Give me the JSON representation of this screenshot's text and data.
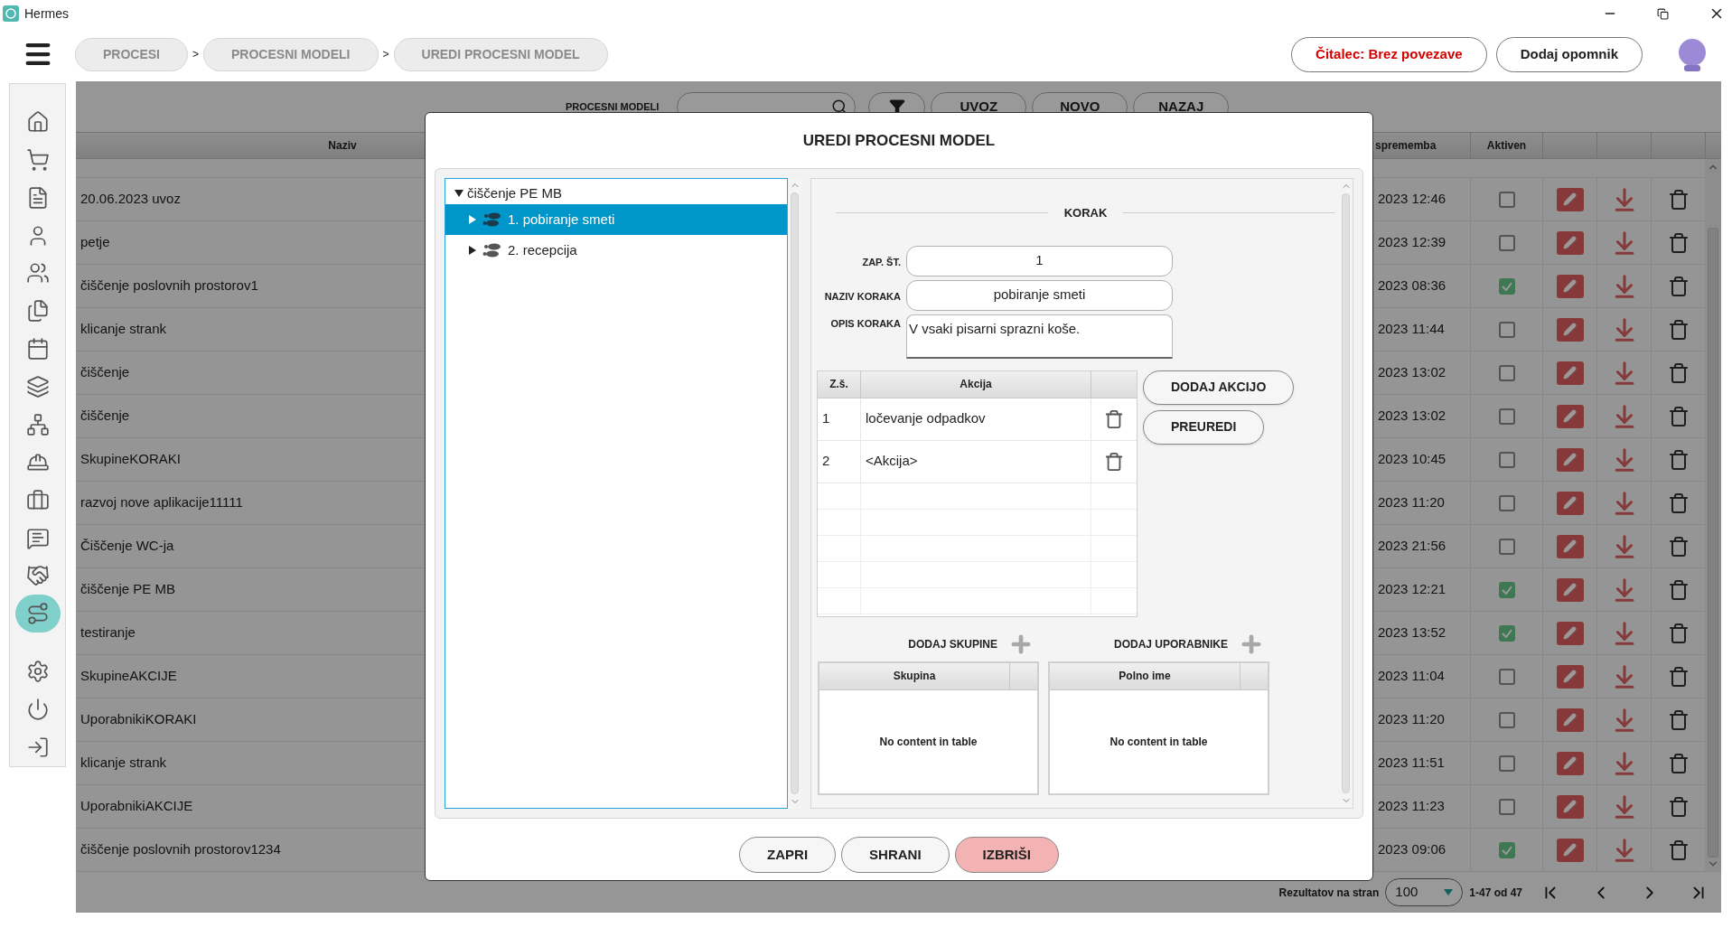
{
  "window": {
    "title": "Hermes"
  },
  "breadcrumbs": [
    {
      "label": "PROCESI",
      "separator": ">"
    },
    {
      "label": "PROCESNI MODELI",
      "separator": ">"
    },
    {
      "label": "UREDI PROCESNI MODEL"
    }
  ],
  "header_buttons": [
    {
      "label": "Čitalec: Brez povezave",
      "kind": "alert"
    },
    {
      "label": "Dodaj opomnik",
      "kind": "normal"
    }
  ],
  "sidebar": {
    "items": [
      {
        "selected": false
      },
      {
        "selected": false
      },
      {
        "selected": false
      },
      {
        "selected": false
      },
      {
        "selected": false
      },
      {
        "selected": false
      },
      {
        "selected": false
      },
      {
        "selected": false
      },
      {
        "selected": false
      },
      {
        "selected": false
      },
      {
        "selected": false
      },
      {
        "selected": false
      },
      {
        "selected": false
      },
      {
        "selected": true
      },
      {
        "selected": false
      },
      {
        "selected": false
      },
      {
        "selected": false
      }
    ]
  },
  "toolbar": {
    "label": "PROCESNI MODELI",
    "buttons": [
      "UVOZ",
      "NOVO",
      "NAZAJ"
    ]
  },
  "table": {
    "columns": [
      "Naziv",
      "sprememba",
      "Aktiven"
    ],
    "rows": [
      {
        "name": "20.06.2023 uvoz",
        "changed": "2023 12:46",
        "active": false
      },
      {
        "name": "petje",
        "changed": "2023 12:39",
        "active": false
      },
      {
        "name": "čiščenje poslovnih prostorov1",
        "changed": "2023 08:36",
        "active": true
      },
      {
        "name": "klicanje strank",
        "changed": "2023 11:44",
        "active": false
      },
      {
        "name": "čiščenje",
        "changed": "2023 13:02",
        "active": false
      },
      {
        "name": "čiščenje",
        "changed": "2023 13:02",
        "active": false
      },
      {
        "name": "SkupineKORAKI",
        "changed": "2023 10:45",
        "active": false
      },
      {
        "name": "razvoj nove aplikacije11111",
        "changed": "2023 11:20",
        "active": false
      },
      {
        "name": "Čiščenje WC-ja",
        "changed": "2023 21:56",
        "active": false
      },
      {
        "name": "čiščenje PE MB",
        "changed": "2023 12:21",
        "active": true
      },
      {
        "name": "testiranje",
        "changed": "2023 13:52",
        "active": true
      },
      {
        "name": "SkupineAKCIJE",
        "changed": "2023 11:04",
        "active": false
      },
      {
        "name": "UporabnikiKORAKI",
        "changed": "2023 11:20",
        "active": false
      },
      {
        "name": "klicanje strank",
        "changed": "2023 11:51",
        "active": false
      },
      {
        "name": "UporabnikiAKCIJE",
        "changed": "2023 11:23",
        "active": false
      },
      {
        "name": "čiščenje poslovnih prostorov1234",
        "changed": "2023 09:06",
        "active": true
      }
    ]
  },
  "pagination": {
    "label": "Rezultatov na stran",
    "page_size": "100",
    "range": "1-47 od 47"
  },
  "dialog": {
    "title": "UREDI PROCESNI MODEL",
    "tree": {
      "label": "čiščenje PE MB",
      "expanded": true,
      "selected": false,
      "children": [
        {
          "label": "1. pobiranje smeti",
          "expanded": false,
          "selected": true
        },
        {
          "label": "2. recepcija",
          "expanded": false,
          "selected": false
        }
      ]
    },
    "section_title": "KORAK",
    "fields": [
      {
        "label": "ZAP. ŠT.",
        "value": "1",
        "kind": "text"
      },
      {
        "label": "NAZIV KORAKA",
        "value": "pobiranje smeti",
        "kind": "text"
      },
      {
        "label": "OPIS KORAKA",
        "value": "V vsaki pisarni sprazni koše.",
        "kind": "textarea"
      }
    ],
    "actions_table": {
      "columns": [
        "Z.š.",
        "Akcija"
      ],
      "rows": [
        {
          "number": "1",
          "action": "ločevanje odpadkov"
        },
        {
          "number": "2",
          "action": "<Akcija>"
        }
      ]
    },
    "action_buttons": [
      "DODAJ AKCIJO",
      "PREUREDI"
    ],
    "groups": {
      "add_label": "DODAJ SKUPINE",
      "column": "Skupina",
      "empty": "No content in table"
    },
    "users": {
      "add_label": "DODAJ UPORABNIKE",
      "column": "Polno ime",
      "empty": "No content in table"
    },
    "buttons": [
      {
        "label": "ZAPRI",
        "kind": "normal"
      },
      {
        "label": "SHRANI",
        "kind": "normal"
      },
      {
        "label": "IZBRIŠI",
        "kind": "danger"
      }
    ]
  }
}
